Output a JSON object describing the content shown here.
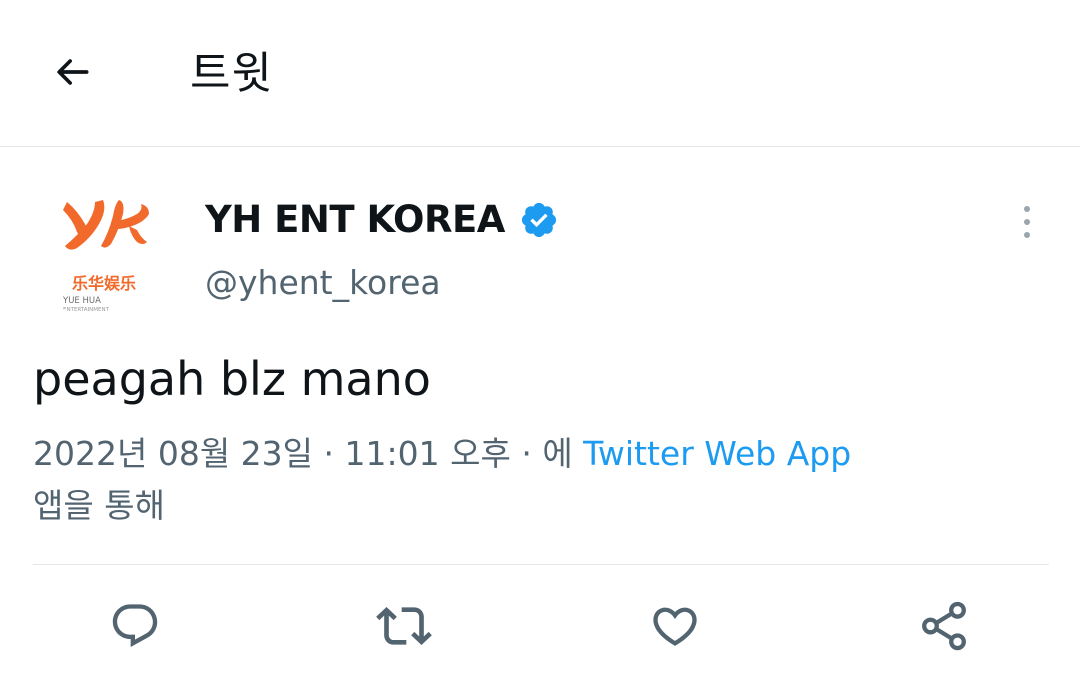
{
  "header": {
    "title": "트윗",
    "back_icon": "arrow-left-icon"
  },
  "tweet": {
    "author": {
      "name": "YH ENT KOREA",
      "handle": "@yhent_korea",
      "verified": true,
      "verified_icon": "verified-badge-icon",
      "avatar": {
        "logo_mark": "YH",
        "chinese_text": "乐华娱乐",
        "english_line1": "YUE HUA",
        "english_line2": "ENTERTAINMENT"
      }
    },
    "more_icon": "more-vertical-icon",
    "text": "peagah blz mano",
    "meta": {
      "date": "2022년 08월 23일",
      "sep1": " · ",
      "time": "11:01 오후",
      "sep2": " · ",
      "via_prefix": "에 ",
      "source": "Twitter Web App",
      "via_suffix": "앱을 통해"
    },
    "actions": [
      {
        "name": "reply",
        "icon": "reply-icon"
      },
      {
        "name": "retweet",
        "icon": "retweet-icon"
      },
      {
        "name": "like",
        "icon": "heart-icon"
      },
      {
        "name": "share",
        "icon": "share-icon"
      }
    ]
  },
  "colors": {
    "text": "#0f1419",
    "secondary": "#536471",
    "link": "#1d9bf0",
    "verified": "#1d9bf0",
    "logo_orange": "#f26a2b",
    "divider": "#e4e7ea",
    "icon": "#536471"
  }
}
